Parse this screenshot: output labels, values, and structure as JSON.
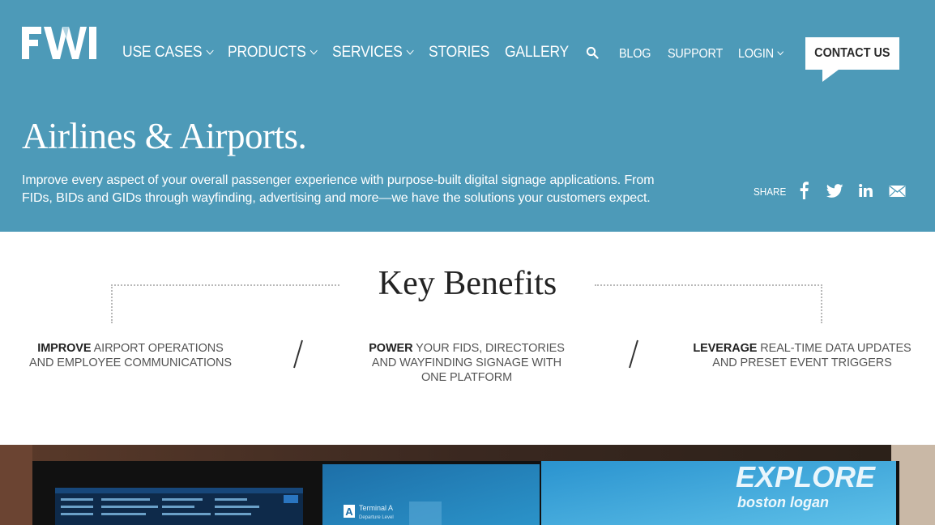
{
  "brand": {
    "logo_text": "FWI"
  },
  "nav": {
    "items": [
      {
        "label": "USE CASES",
        "dropdown": true
      },
      {
        "label": "PRODUCTS",
        "dropdown": true
      },
      {
        "label": "SERVICES",
        "dropdown": true
      },
      {
        "label": "STORIES",
        "dropdown": false
      },
      {
        "label": "GALLERY",
        "dropdown": false
      }
    ],
    "search_icon": "search-icon",
    "secondary": [
      {
        "label": "BLOG",
        "dropdown": false
      },
      {
        "label": "SUPPORT",
        "dropdown": false
      },
      {
        "label": "LOGIN",
        "dropdown": true
      }
    ],
    "contact_label": "CONTACT US"
  },
  "hero": {
    "title": "Airlines & Airports.",
    "description": "Improve every aspect of your overall passenger experience with purpose-built digital signage applications. From FIDs, BIDs and GIDs through wayfinding, advertising and more—we have the solutions your customers expect.",
    "share_label": "SHARE",
    "social_icons": [
      "facebook-icon",
      "twitter-icon",
      "linkedin-icon",
      "email-icon"
    ]
  },
  "benefits": {
    "title": "Key Benefits",
    "items": [
      {
        "bold": "IMPROVE",
        "text": " AIRPORT OPERATIONS AND EMPLOYEE COMMUNICATIONS"
      },
      {
        "bold": "POWER",
        "text": " YOUR FIDS, DIRECTORIES AND WAYFINDING SIGNAGE WITH ONE PLATFORM"
      },
      {
        "bold": "LEVERAGE",
        "text": " REAL-TIME DATA UPDATES AND PRESET EVENT TRIGGERS"
      }
    ]
  },
  "photo": {
    "screen_texts": [
      "EXPLORE",
      "boston logan",
      "Terminal A",
      "Departure Level",
      "A"
    ]
  },
  "colors": {
    "hero_bg": "#4d9ab8",
    "text_dark": "#222222",
    "dotted_rule": "#b8b8b8"
  }
}
